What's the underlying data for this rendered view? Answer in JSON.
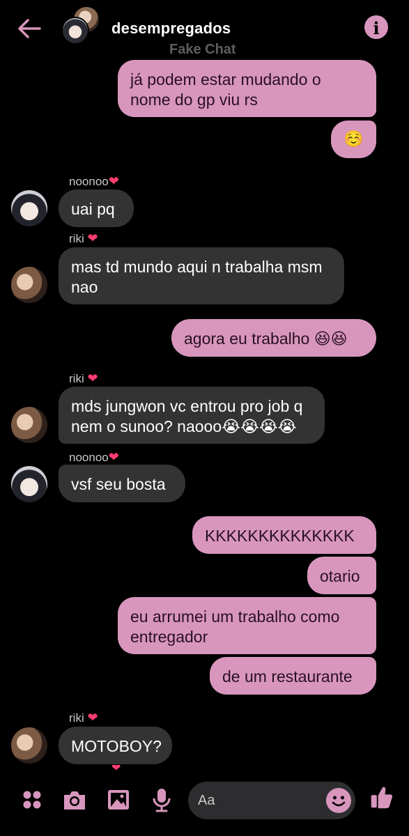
{
  "header": {
    "title": "desempregados",
    "subtitle": "Fake Chat"
  },
  "messages": {
    "m1": "já podem estar mudando o nome do gp viu rs",
    "m2": "☺️",
    "s1": "noonoo",
    "m3": "uai pq",
    "s2": "riki",
    "m4": "mas td mundo aqui n trabalha msm nao",
    "m5": "agora eu trabalho 😆😆",
    "s3": "riki",
    "m6": "mds jungwon vc entrou pro job q nem o sunoo? naooo😭😭😭😭",
    "s4": "noonoo",
    "m7": "vsf seu bosta",
    "m8": "KKKKKKKKKKKKKK",
    "m9": "otario",
    "m10": "eu arrumei um trabalho como entregador",
    "m11": "de um restaurante",
    "s5": "riki",
    "m12": "MOTOBOY?"
  },
  "composer": {
    "placeholder": "Aa"
  },
  "icons": {
    "back": "back-arrow-icon",
    "info": "info-icon",
    "apps": "apps-grid-icon",
    "camera": "camera-icon",
    "gallery": "gallery-icon",
    "mic": "microphone-icon",
    "emoji": "emoji-icon",
    "like": "thumbs-up-icon"
  },
  "colors": {
    "accent": "#d896bd",
    "outgoing_bubble": "#d896bd",
    "incoming_bubble": "#333334",
    "background": "#000000"
  }
}
